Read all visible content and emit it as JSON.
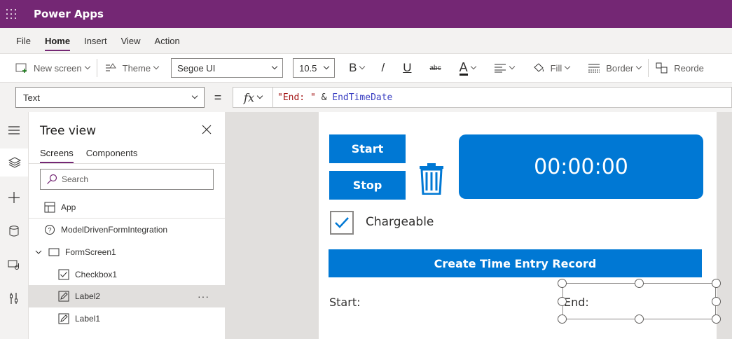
{
  "app": {
    "title": "Power Apps"
  },
  "menu": {
    "tabs": [
      {
        "label": "File"
      },
      {
        "label": "Home",
        "active": true
      },
      {
        "label": "Insert"
      },
      {
        "label": "View"
      },
      {
        "label": "Action"
      }
    ]
  },
  "ribbon": {
    "new_screen": "New screen",
    "theme": "Theme",
    "font_family": "Segoe UI",
    "font_size": "10.5",
    "bold": "B",
    "italic": "/",
    "underline": "U",
    "strikethrough": "abc",
    "font_color": "A",
    "fill": "Fill",
    "border": "Border",
    "reorder": "Reorde"
  },
  "formula_bar": {
    "property": "Text",
    "equals": "=",
    "fx": "fx",
    "formula_string": "\"End: \"",
    "formula_operator": " & ",
    "formula_identifier": "EndTimeDate"
  },
  "tree_view": {
    "title": "Tree view",
    "tabs": [
      {
        "label": "Screens",
        "active": true
      },
      {
        "label": "Components"
      }
    ],
    "search_placeholder": "Search",
    "items": [
      {
        "label": "App",
        "icon": "app-grid-icon"
      },
      {
        "label": "ModelDrivenFormIntegration",
        "icon": "help-circle-icon"
      },
      {
        "label": "FormScreen1",
        "icon": "screen-icon"
      },
      {
        "label": "Checkbox1",
        "icon": "checkbox-icon"
      },
      {
        "label": "Label2",
        "icon": "label-edit-icon",
        "selected": true,
        "more": "···"
      },
      {
        "label": "Label1",
        "icon": "label-edit-icon"
      }
    ]
  },
  "canvas": {
    "start_button": "Start",
    "stop_button": "Stop",
    "timer": "00:00:00",
    "checkbox_label": "Chargeable",
    "checkbox_checked": true,
    "create_button": "Create Time Entry Record",
    "start_label": "Start:",
    "end_label": "End:"
  },
  "colors": {
    "brand": "#742774",
    "accent": "#0078d4"
  }
}
